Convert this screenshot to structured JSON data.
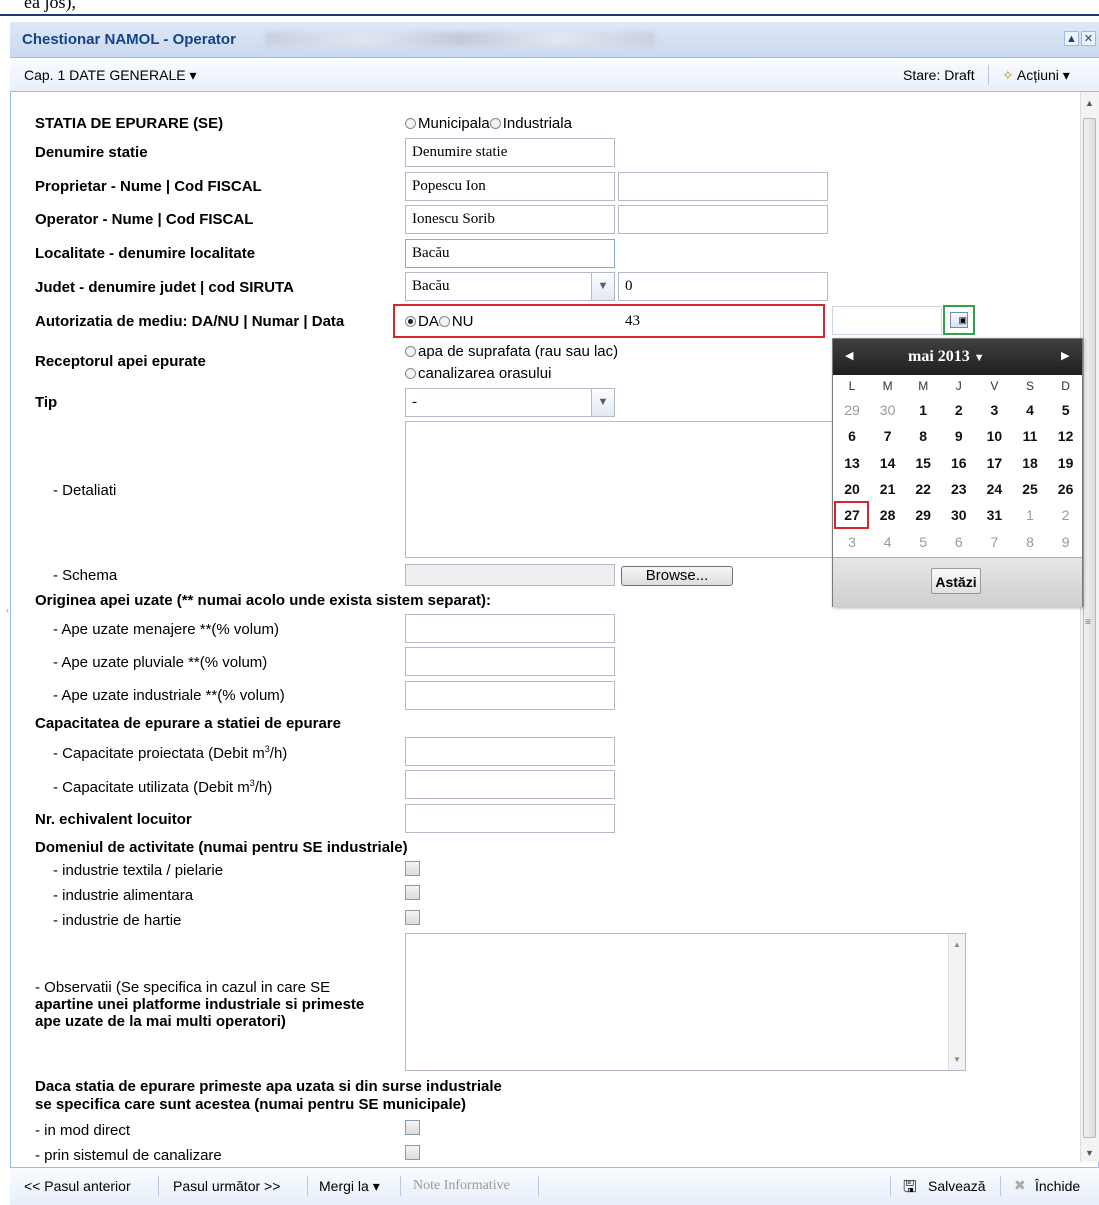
{
  "top_strip_text": "ea jos),",
  "window": {
    "title": "Chestionar NAMOL - Operator",
    "toolbar": {
      "chapter": "Cap. 1 DATE GENERALE",
      "status": "Stare: Draft",
      "actions": "Acțiuni"
    }
  },
  "form": {
    "statia_label": "STATIA DE EPURARE (SE)",
    "statia_options": [
      "Municipala",
      "Industriala"
    ],
    "denumire_label": "Denumire statie",
    "denumire_value": "Denumire statie",
    "proprietar_label": "Proprietar - Nume | Cod FISCAL",
    "proprietar_name": "Popescu Ion",
    "proprietar_cod": "",
    "operator_label": "Operator - Nume | Cod FISCAL",
    "operator_name": "Ionescu Sorib",
    "operator_cod": "",
    "localitate_label": "Localitate - denumire localitate",
    "localitate_value": "Bacău",
    "judet_label": "Judet - denumire judet | cod SIRUTA",
    "judet_value": "Bacău",
    "siruta_value": "0",
    "autorizatia_label": "Autorizatia de mediu: DA/NU | Numar | Data",
    "autorizatia_options": [
      "DA",
      "NU"
    ],
    "autorizatia_selected": "DA",
    "autorizatia_numar": "43",
    "autorizatia_data": "",
    "receptor_label": "Receptorul apei epurate",
    "receptor_options": [
      "apa de suprafata (rau sau lac)",
      "canalizarea orasului"
    ],
    "tip_label": "Tip",
    "tip_value": "-",
    "detaliati_label": "- Detaliati",
    "schema_label": "- Schema",
    "browse_label": "Browse...",
    "originea_label": "Originea apei uzate (** numai acolo unde exista sistem separat):",
    "menajere_label": "- Ape uzate menajere **(% volum)",
    "pluviale_label": "- Ape uzate pluviale **(% volum)",
    "industriale_label": "- Ape uzate industriale **(% volum)",
    "capacitatea_label": "Capacitatea de epurare a statiei de epurare",
    "cap_proiectata_label": "- Capacitate proiectata (Debit m",
    "cap_utilizata_label": "- Capacitate utilizata (Debit m",
    "unit_sup": "3",
    "unit_tail": "/h)",
    "echivalent_label": "Nr. echivalent locuitor",
    "domeniul_label": "Domeniul de activitate (numai pentru SE industriale)",
    "textila_label": "- industrie textila / pielarie",
    "alimentara_label": "- industrie alimentara",
    "hartie_label": "- industrie de hartie",
    "observatii_line1": "- Observatii (Se specifica in cazul in care SE",
    "observatii_line2": "apartine unei platforme industriale si primeste",
    "observatii_line3": "ape uzate de la mai multi operatori)",
    "daca_line1": "Daca statia de epurare primeste apa uzata si din surse industriale",
    "daca_line2": "se specifica care sunt acestea (numai pentru SE municipale)",
    "direct_label": "- in mod direct",
    "canalizare_label": "- prin sistemul de canalizare"
  },
  "calendar": {
    "month_label": "mai 2013",
    "weekdays": [
      "L",
      "M",
      "M",
      "J",
      "V",
      "S",
      "D"
    ],
    "weeks": [
      [
        "29",
        "30",
        "1",
        "2",
        "3",
        "4",
        "5"
      ],
      [
        "6",
        "7",
        "8",
        "9",
        "10",
        "11",
        "12"
      ],
      [
        "13",
        "14",
        "15",
        "16",
        "17",
        "18",
        "19"
      ],
      [
        "20",
        "21",
        "22",
        "23",
        "24",
        "25",
        "26"
      ],
      [
        "27",
        "28",
        "29",
        "30",
        "31",
        "1",
        "2"
      ],
      [
        "3",
        "4",
        "5",
        "6",
        "7",
        "8",
        "9"
      ]
    ],
    "selected_day": "27",
    "today_label": "Astăzi"
  },
  "bottom_toolbar": {
    "prev": "<< Pasul anterior",
    "next": "Pasul următor >>",
    "goto": "Mergi la",
    "notes": "Note Informative",
    "save": "Salvează",
    "close": "Închide"
  },
  "colors": {
    "highlight_red": "#d9262e",
    "highlight_green": "#2fa34a",
    "title_text": "#15428b"
  }
}
